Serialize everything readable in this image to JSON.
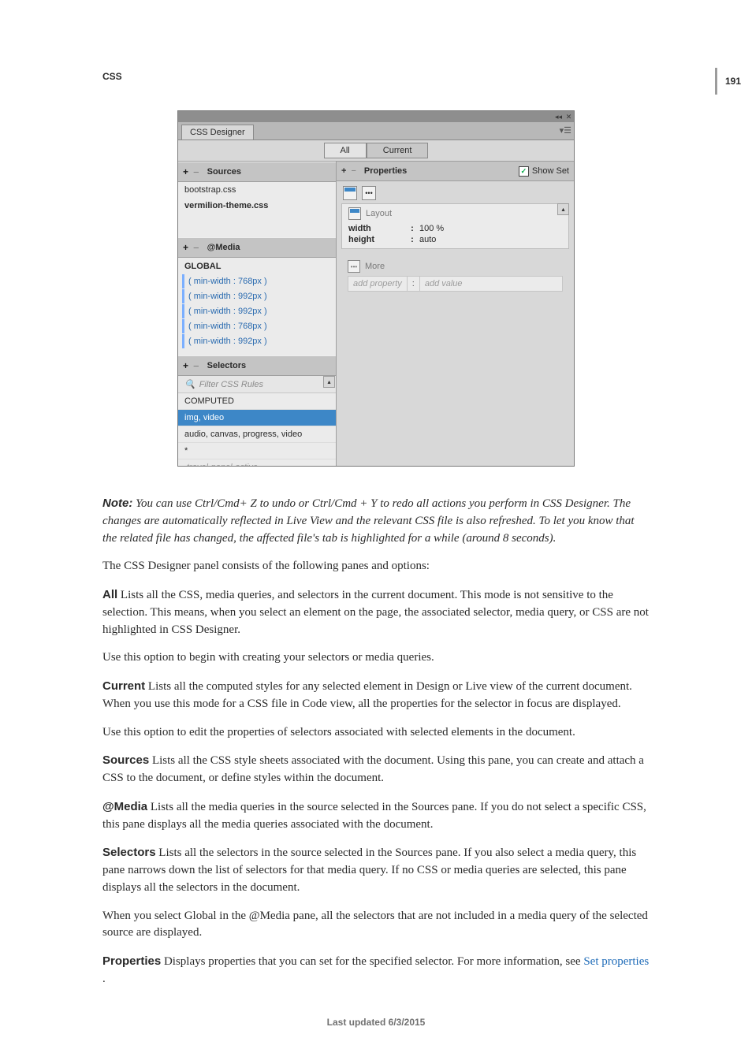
{
  "page_number": "191",
  "section": "CSS",
  "panel": {
    "tab_label": "CSS Designer",
    "mode_tabs": {
      "all": "All",
      "current": "Current"
    },
    "sources": {
      "header": "Sources",
      "items": [
        "bootstrap.css",
        "vermilion-theme.css"
      ]
    },
    "media": {
      "header": "@Media",
      "global": "GLOBAL",
      "items": [
        "( min-width : 768px )",
        "( min-width : 992px )",
        "( min-width : 992px )",
        "( min-width : 768px )",
        "( min-width : 992px )"
      ]
    },
    "selectors": {
      "header": "Selectors",
      "filter_placeholder": "Filter CSS Rules",
      "items": [
        "COMPUTED",
        "img, video",
        "audio, canvas, progress, video",
        "*"
      ],
      "cutoff": ".travel-panel-active"
    },
    "properties": {
      "header": "Properties",
      "show_set": "Show Set",
      "layout_label": "Layout",
      "rows": [
        {
          "k": "width",
          "v": "100 %"
        },
        {
          "k": "height",
          "v": "auto"
        }
      ],
      "more_label": "More",
      "add_property": "add property",
      "add_value": "add value"
    }
  },
  "body": {
    "note_prefix": "Note:",
    "note_text": " You can use Ctrl/Cmd+ Z to undo or Ctrl/Cmd + Y to redo all actions you perform in CSS Designer. The changes are automatically reflected in Live View and the relevant CSS file is also refreshed. To let you know that the related file has changed, the affected file's tab is highlighted for a while (around 8 seconds).",
    "p1": "The CSS Designer panel consists of the following panes and options:",
    "t_all": "All",
    "d_all": "  Lists all the CSS, media queries, and selectors in the current document. This mode is not sensitive to the selection. This means, when you select an element on the page, the associated selector, media query, or CSS are not highlighted in CSS Designer.",
    "p_all2": "Use this option to begin with creating your selectors or media queries.",
    "t_current": "Current",
    "d_current": "  Lists all the computed styles for any selected element in Design or Live view of the current document. When you use this mode for a CSS file in Code view, all the properties for the selector in focus are displayed.",
    "p_current2": "Use this option to edit the properties of selectors associated with selected elements in the document.",
    "t_sources": "Sources",
    "d_sources": "  Lists all the CSS style sheets associated with the document. Using this pane, you can create and attach a CSS to the document, or define styles within the document.",
    "t_media": "@Media",
    "d_media": "  Lists all the media queries in the source selected in the Sources pane. If you do not select a specific CSS, this pane displays all the media queries associated with the document.",
    "t_selectors": "Selectors",
    "d_selectors": "  Lists all the selectors in the source selected in the Sources pane. If you also select a media query, this pane narrows down the list of selectors for that media query. If no CSS or media queries are selected, this pane displays all the selectors in the document.",
    "p_selectors2": "When you select Global in the @Media pane, all the selectors that are not included in a media query of the selected source are displayed.",
    "t_properties": "Properties",
    "d_properties_pre": "  Displays properties that you can set for the specified selector. For more information, see ",
    "link_set_properties": "Set properties",
    "d_properties_post": " ."
  },
  "footer": "Last updated 6/3/2015"
}
